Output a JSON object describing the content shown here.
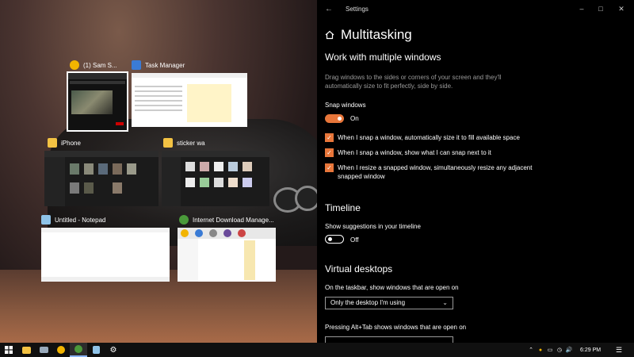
{
  "task_view": {
    "windows": [
      {
        "title": "(1) Sam S...",
        "icon": "chrome-icon"
      },
      {
        "title": "Task Manager",
        "icon": "task-manager-icon"
      },
      {
        "title": "iPhone",
        "icon": "folder-icon"
      },
      {
        "title": "sticker wa",
        "icon": "folder-icon"
      },
      {
        "title": "Untitled - Notepad",
        "icon": "notepad-icon"
      },
      {
        "title": "Internet Download Manage...",
        "icon": "idm-icon"
      }
    ]
  },
  "settings": {
    "window_title": "Settings",
    "page_title": "Multitasking",
    "section1": {
      "title": "Work with multiple windows",
      "description": "Drag windows to the sides or corners of your screen and they'll automatically size to fit perfectly, side by side.",
      "snap_label": "Snap windows",
      "snap_state": "On",
      "options": [
        "When I snap a window, automatically size it to fill available space",
        "When I snap a window, show what I can snap next to it",
        "When I resize a snapped window, simultaneously resize any adjacent snapped window"
      ]
    },
    "section2": {
      "title": "Timeline",
      "suggest_label": "Show suggestions in your timeline",
      "suggest_state": "Off"
    },
    "section3": {
      "title": "Virtual desktops",
      "taskbar_label": "On the taskbar, show windows that are open on",
      "taskbar_value": "Only the desktop I'm using",
      "alttab_label": "Pressing Alt+Tab shows windows that are open on"
    }
  },
  "taskbar": {
    "clock": "6:29 PM"
  },
  "colors": {
    "accent": "#e8763a",
    "settings_bg": "#000000",
    "taskbar_bg": "#101010"
  }
}
